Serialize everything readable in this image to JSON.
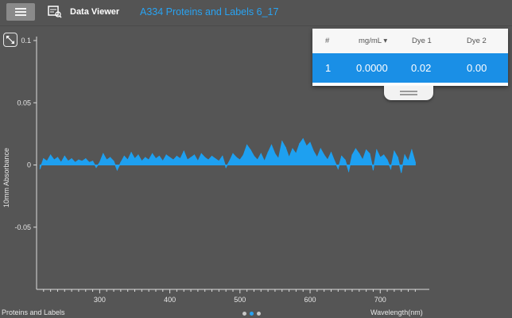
{
  "header": {
    "menu_icon": "hamburger-menu-icon",
    "app_icon": "data-viewer-icon",
    "app_title": "Data Viewer",
    "document_title": "A334 Proteins and Labels 6_17"
  },
  "colors": {
    "background": "#555555",
    "accent": "#1a8fe6",
    "spectrum_fill": "#1ea0f0",
    "link_text": "#29a3f2"
  },
  "results_table": {
    "columns": [
      "#",
      "mg/mL",
      "Dye 1",
      "Dye 2"
    ],
    "sort_indicator": "▾",
    "rows": [
      {
        "index": "1",
        "mg_ml": "0.0000",
        "dye1": "0.02",
        "dye2": "0.00"
      }
    ]
  },
  "footer": {
    "app_name": "Proteins and Labels",
    "page_count": 3,
    "active_page": 2
  },
  "chart_data": {
    "type": "area",
    "xlabel": "Wavelength(nm)",
    "ylabel": "10mm Absorbance",
    "xlim": [
      210,
      770
    ],
    "ylim": [
      -0.1,
      0.1
    ],
    "x_ticks": [
      300,
      400,
      500,
      600,
      700
    ],
    "y_ticks": [
      0.1,
      0.05,
      0,
      -0.05
    ],
    "y_tick_labels": [
      "0.1",
      "0.05",
      "0",
      "-0.05"
    ],
    "x_tick_labels": [
      "300",
      "400",
      "500",
      "600",
      "700"
    ],
    "series": [
      {
        "x": [
          215,
          220,
          225,
          230,
          235,
          240,
          245,
          250,
          255,
          260,
          265,
          270,
          275,
          280,
          285,
          290,
          295,
          300,
          305,
          310,
          315,
          320,
          325,
          330,
          335,
          340,
          345,
          350,
          355,
          360,
          365,
          370,
          375,
          380,
          385,
          390,
          395,
          400,
          405,
          410,
          415,
          420,
          425,
          430,
          435,
          440,
          445,
          450,
          455,
          460,
          465,
          470,
          475,
          480,
          485,
          490,
          495,
          500,
          505,
          510,
          515,
          520,
          525,
          530,
          535,
          540,
          545,
          550,
          555,
          560,
          565,
          570,
          575,
          580,
          585,
          590,
          595,
          600,
          605,
          610,
          615,
          620,
          625,
          630,
          635,
          640,
          645,
          650,
          655,
          660,
          665,
          670,
          675,
          680,
          685,
          690,
          695,
          700,
          705,
          710,
          715,
          720,
          725,
          730,
          735,
          740,
          745,
          750
        ],
        "y": [
          -0.003,
          0.005,
          0.003,
          0.008,
          0.004,
          0.006,
          0.002,
          0.007,
          0.003,
          0.005,
          0.002,
          0.004,
          0.003,
          0.005,
          0.002,
          0.003,
          -0.002,
          0.002,
          0.009,
          0.004,
          0.006,
          0.003,
          -0.004,
          0.002,
          0.007,
          0.004,
          0.01,
          0.005,
          0.008,
          0.003,
          0.006,
          0.004,
          0.009,
          0.005,
          0.007,
          0.003,
          0.008,
          0.006,
          0.004,
          0.007,
          0.005,
          0.011,
          0.004,
          0.006,
          0.008,
          0.003,
          0.009,
          0.006,
          0.004,
          0.007,
          0.005,
          0.003,
          0.007,
          -0.002,
          0.003,
          0.009,
          0.006,
          0.004,
          0.008,
          0.016,
          0.012,
          0.007,
          0.004,
          0.009,
          0.003,
          0.01,
          0.016,
          0.009,
          0.005,
          0.019,
          0.014,
          0.006,
          0.013,
          0.009,
          0.017,
          0.021,
          0.015,
          0.018,
          0.011,
          0.006,
          0.013,
          0.008,
          0.004,
          0.01,
          0.003,
          -0.003,
          0.007,
          0.004,
          -0.005,
          0.008,
          0.013,
          0.009,
          0.004,
          0.012,
          0.009,
          -0.004,
          0.012,
          0.006,
          0.008,
          0.004,
          -0.003,
          0.011,
          0.006,
          -0.006,
          0.008,
          0.003,
          0.012,
          0.002
        ]
      }
    ]
  }
}
